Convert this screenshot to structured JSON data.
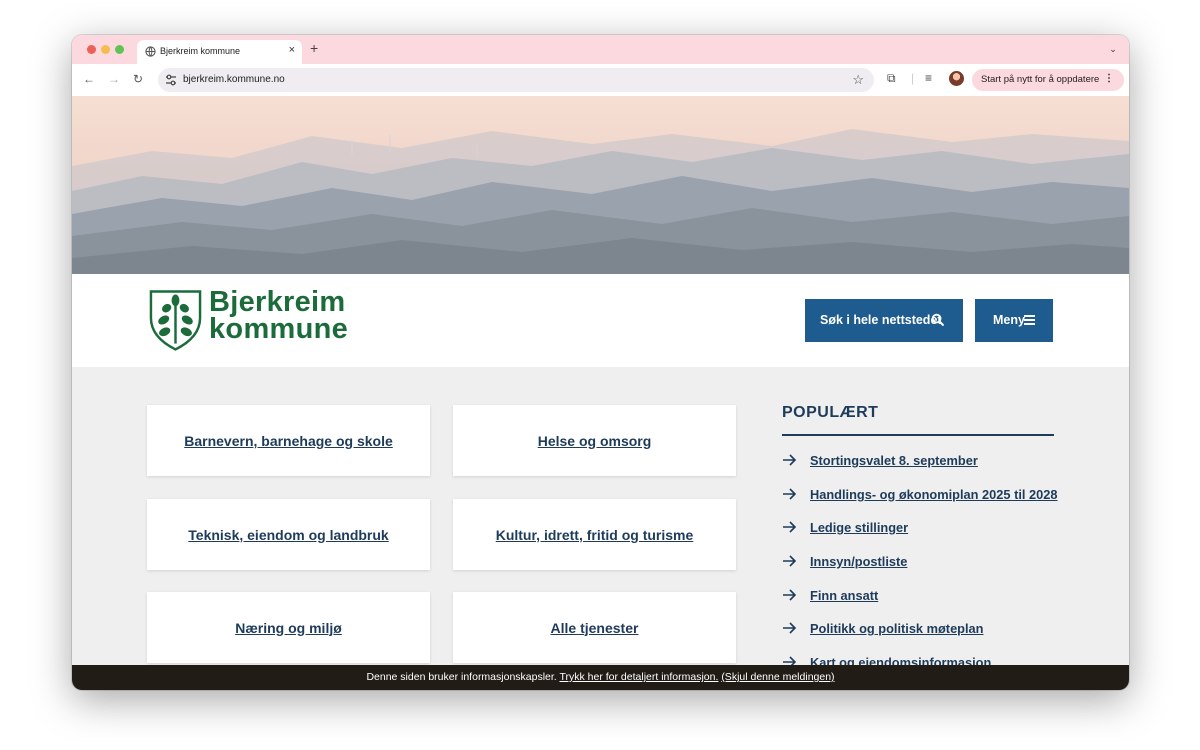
{
  "browser": {
    "tab_title": "Bjerkreim kommune",
    "tab_close": "×",
    "new_tab": "+",
    "tab_dropdown": "⌄",
    "back": "←",
    "forward": "→",
    "reload": "↻",
    "url": "bjerkreim.kommune.no",
    "bookmark": "☆",
    "extensions": "⧉",
    "media": "≡",
    "update_label": "Start på nytt for å oppdatere",
    "update_more": "⋮"
  },
  "header": {
    "logo_line1": "Bjerkreim",
    "logo_line2": "kommune",
    "search_label": "Søk i hele nettstedet",
    "menu_label": "Meny"
  },
  "services": [
    "Barnevern, barnehage og skole",
    "Helse og omsorg",
    "Teknisk, eiendom og landbruk",
    "Kultur, idrett, fritid og turisme",
    "Næring og miljø",
    "Alle tjenester"
  ],
  "popular": {
    "title": "POPULÆRT",
    "items": [
      "Stortingsvalet 8. september",
      "Handlings- og økonomiplan 2025 til 2028",
      "Ledige stillinger",
      "Innsyn/postliste",
      "Finn ansatt",
      "Politikk og politisk møteplan",
      "Kart og eiendomsinformasjon"
    ]
  },
  "cookie": {
    "text": "Denne siden bruker informasjonskapsler.",
    "details_link": "Trykk her for detaljert informasjon.",
    "hide_link": "(Skjul denne meldingen)"
  },
  "colors": {
    "brand_green": "#1c6b3a",
    "button_blue": "#1e5b8f",
    "link_navy": "#1e3b5a",
    "tab_pink": "#fbd9df"
  }
}
